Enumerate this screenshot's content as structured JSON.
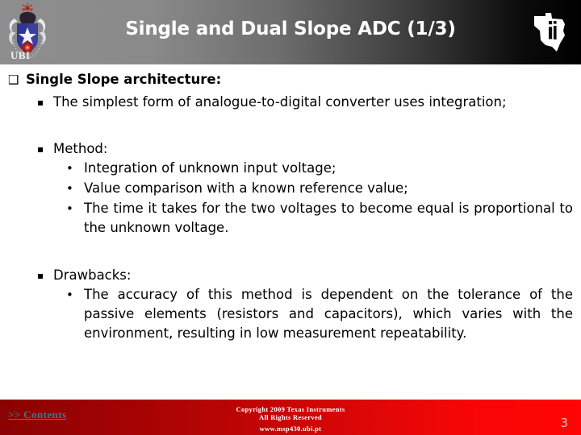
{
  "header": {
    "title": "Single and Dual Slope ADC (1/3)",
    "university_label": "UBI",
    "university_logo_icon": "ubi-coat-of-arms-icon",
    "vendor_logo_icon": "texas-instruments-logo-icon",
    "gradient_from": "#8e8e8e",
    "gradient_to": "#000000"
  },
  "content": {
    "blocks": [
      {
        "level": 1,
        "marker": "❑",
        "text": "Single Slope architecture:"
      },
      {
        "level": 2,
        "marker": "▪",
        "text": "The simplest form of analogue-to-digital converter uses integration;"
      },
      {
        "level": 2,
        "marker": "▪",
        "text": "Method:"
      },
      {
        "level": 3,
        "marker": "•",
        "text": "Integration of unknown input voltage;"
      },
      {
        "level": 3,
        "marker": "•",
        "text": "Value comparison with a known reference value;"
      },
      {
        "level": 3,
        "marker": "•",
        "text": "The time it takes for the two voltages to become equal is proportional to the unknown voltage."
      },
      {
        "level": 2,
        "marker": "▪",
        "text": "Drawbacks:"
      },
      {
        "level": 3,
        "marker": "•",
        "text": "The accuracy of this method is dependent on the tolerance of the passive elements (resistors and capacitors), which varies with the environment, resulting in low measurement repeatability."
      }
    ]
  },
  "footer": {
    "contents_link": ">> Contents",
    "copyright_line1": "Copyright 2009 Texas Instruments",
    "copyright_line2": "All Rights Reserved",
    "website": "www.msp430.ubi.pt",
    "page_number": "3",
    "gradient_from": "#8a0202",
    "gradient_to": "#ff0505",
    "link_color": "#2e7f84"
  }
}
